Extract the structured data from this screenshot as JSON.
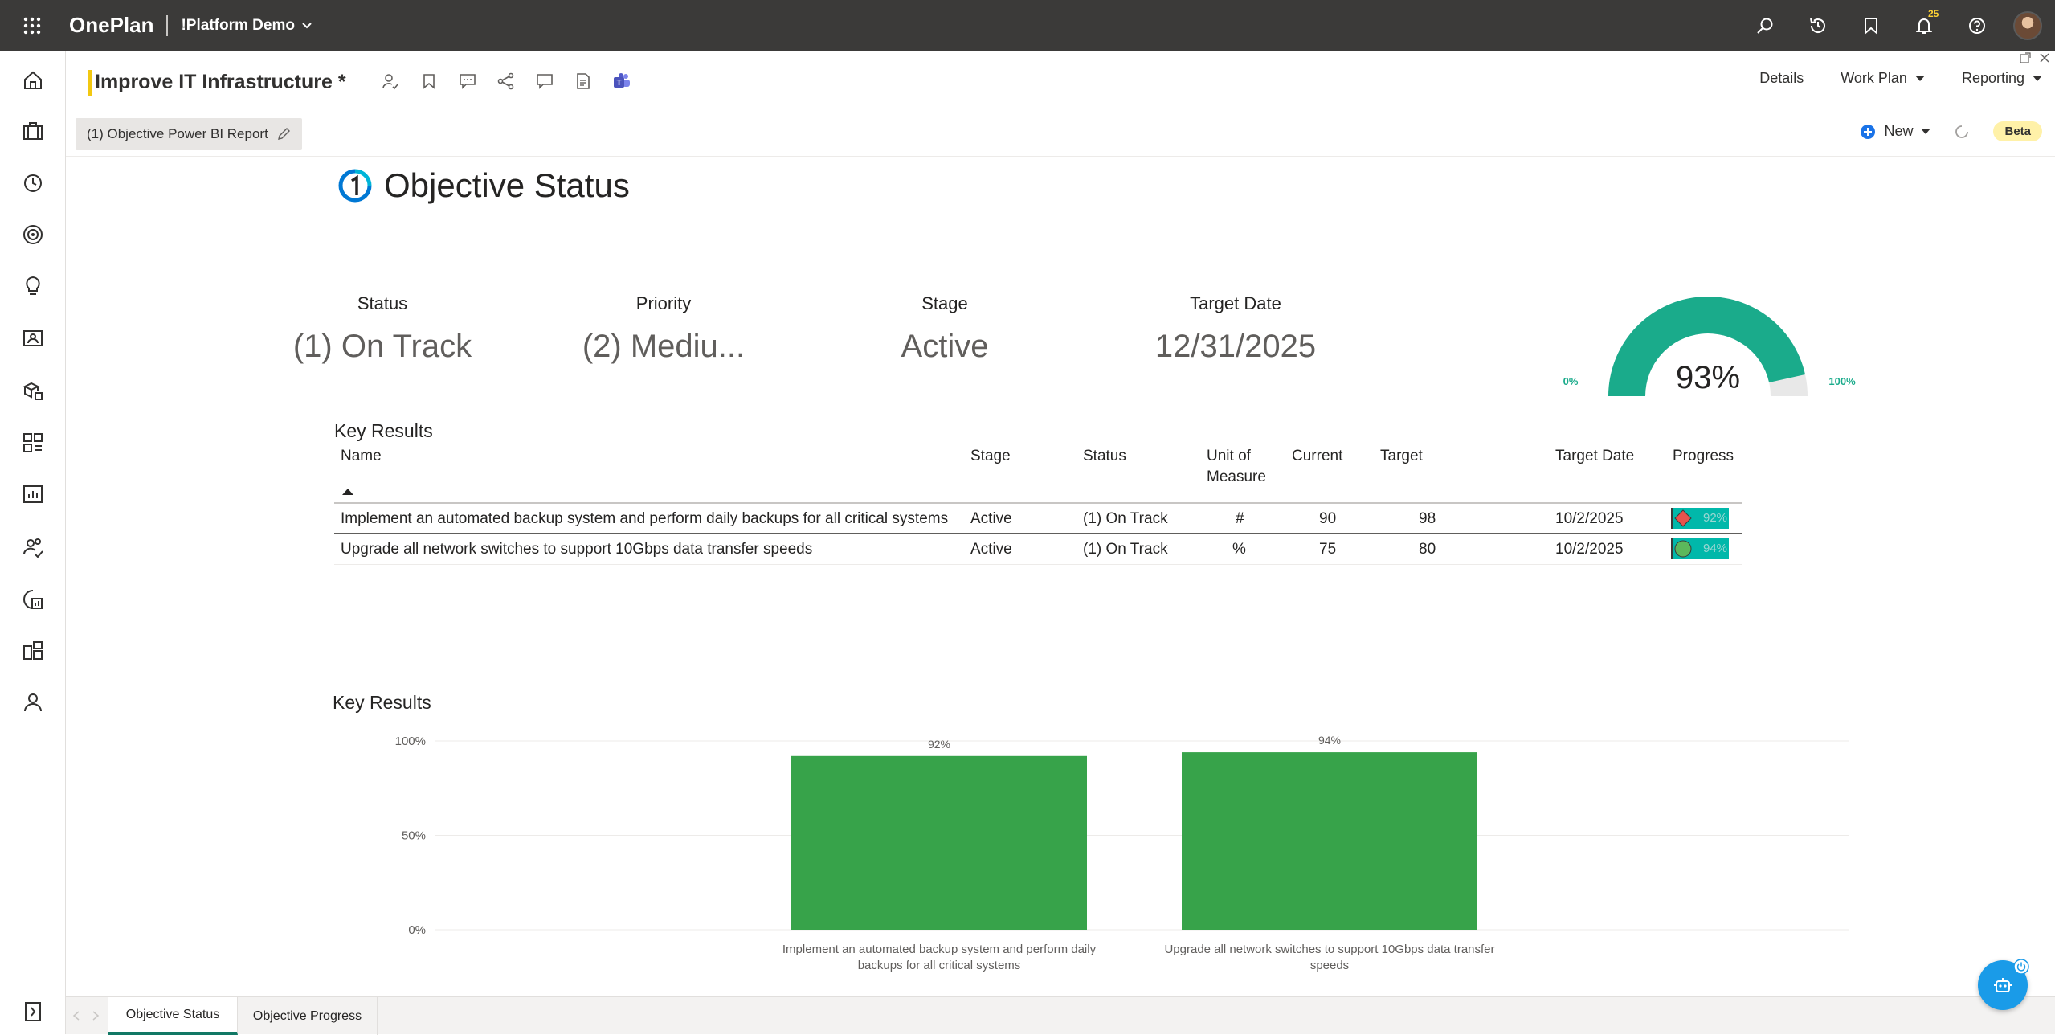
{
  "app": {
    "brand": "OnePlan",
    "tenant": "!Platform Demo",
    "notification_count": "25"
  },
  "header": {
    "title": "Improve IT Infrastructure *",
    "tabs": [
      {
        "label": "Details"
      },
      {
        "label": "Work Plan"
      },
      {
        "label": "Reporting"
      }
    ]
  },
  "report_bar": {
    "report_name": "(1) Objective Power BI Report",
    "new_label": "New",
    "beta_label": "Beta"
  },
  "report": {
    "title": "Objective Status",
    "cards": [
      {
        "label": "Status",
        "value": "(1) On Track"
      },
      {
        "label": "Priority",
        "value": "(2) Mediu..."
      },
      {
        "label": "Stage",
        "value": "Active"
      },
      {
        "label": "Target Date",
        "value": "12/31/2025"
      }
    ],
    "gauge": {
      "value": 93,
      "display": "93%",
      "min_label": "0%",
      "max_label": "100%",
      "color": "#1aab8b"
    },
    "table": {
      "title": "Key Results",
      "columns": [
        "Name",
        "Stage",
        "Status",
        "Unit of Measure",
        "Current",
        "Target",
        "Target Date",
        "Progress"
      ],
      "rows": [
        {
          "name": "Implement an automated backup system and perform daily backups for all critical systems",
          "stage": "Active",
          "status": "(1) On Track",
          "unit": "#",
          "current": "90",
          "target": "98",
          "target_date": "10/2/2025",
          "progress": "92%",
          "indicator": "red-diamond"
        },
        {
          "name": "Upgrade all network switches to support 10Gbps data transfer speeds",
          "stage": "Active",
          "status": "(1) On Track",
          "unit": "%",
          "current": "75",
          "target": "80",
          "target_date": "10/2/2025",
          "progress": "94%",
          "indicator": "green-circle"
        }
      ]
    },
    "chart_title": "Key Results"
  },
  "chart_data": {
    "type": "bar",
    "categories": [
      "Implement an automated backup system and perform daily backups for all critical systems",
      "Upgrade all network switches to support 10Gbps data transfer speeds"
    ],
    "category_lines": [
      [
        "Implement an automated backup system and perform daily",
        "backups for all critical systems"
      ],
      [
        "Upgrade all network switches to support 10Gbps data transfer",
        "speeds"
      ]
    ],
    "values": [
      92,
      94
    ],
    "data_labels": [
      "92%",
      "94%"
    ],
    "ylim": [
      0,
      100
    ],
    "yticks": [
      "0%",
      "50%",
      "100%"
    ],
    "grid": true,
    "color": "#37a34a"
  },
  "bottom_tabs": [
    {
      "label": "Objective Status",
      "active": true
    },
    {
      "label": "Objective Progress",
      "active": false
    }
  ]
}
